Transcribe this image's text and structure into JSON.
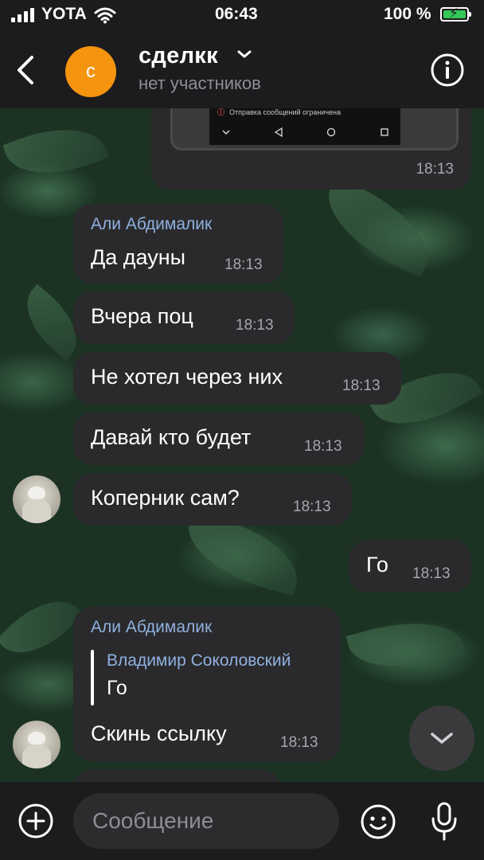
{
  "status_bar": {
    "carrier": "YOTA",
    "time": "06:43",
    "battery_percent": "100 %",
    "battery_level": 1.0,
    "charging": true
  },
  "header": {
    "avatar_letter": "с",
    "avatar_color": "#f5940f",
    "title": "сделкк",
    "subtitle": "нет участников",
    "icons": {
      "back": "chevron-left-icon",
      "title_menu": "chevron-down-icon",
      "info": "info-icon"
    }
  },
  "messages": [
    {
      "type": "image",
      "image_notice": "Отправка сообщений ограничена",
      "time": "18:13"
    },
    {
      "sender": "Али Абдималик",
      "text": "Да дауны",
      "time": "18:13"
    },
    {
      "text": "Вчера поц",
      "time": "18:13"
    },
    {
      "text": "Не хотел через них",
      "time": "18:13"
    },
    {
      "text": "Давай кто будет",
      "time": "18:13"
    },
    {
      "text": "Коперник сам?",
      "time": "18:13"
    },
    {
      "outgoing": true,
      "text": "Го",
      "time": "18:13"
    },
    {
      "sender": "Али Абдималик",
      "reply_to": {
        "name": "Владимир Соколовский",
        "text": "Го"
      },
      "text": "Скинь ссылку",
      "time": "18:13"
    }
  ],
  "composer": {
    "placeholder": "Сообщение",
    "value": "",
    "icons": {
      "attach": "plus-icon",
      "emoji": "emoji-icon",
      "voice": "microphone-icon",
      "scroll": "chevron-down-icon"
    }
  },
  "colors": {
    "bubble": "#2a2a2c",
    "sender_name": "#8fb0df",
    "bar_background": "#1c1c1e",
    "battery": "#34c759"
  }
}
